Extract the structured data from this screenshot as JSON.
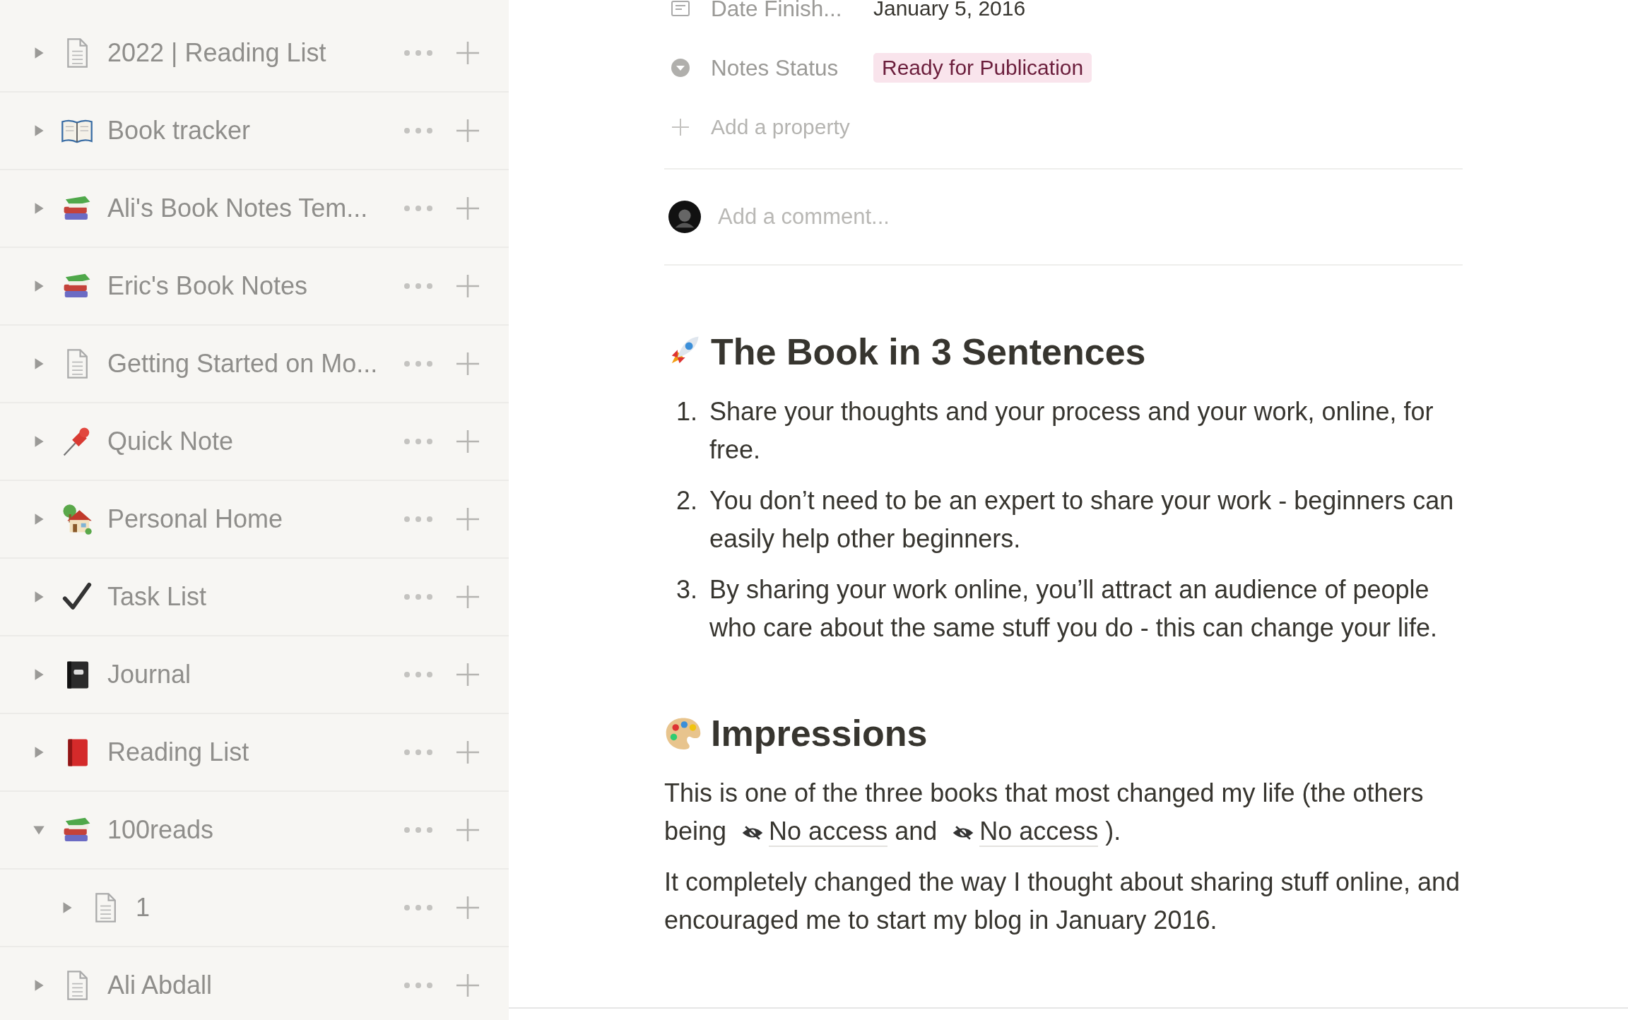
{
  "sidebar": {
    "items": [
      {
        "label": "2022 | Reading List",
        "kind": "page",
        "expanded": false
      },
      {
        "label": "Book tracker",
        "kind": "open-book",
        "expanded": false
      },
      {
        "label": "Ali's Book Notes Tem...",
        "kind": "books",
        "expanded": false
      },
      {
        "label": "Eric's Book Notes",
        "kind": "books",
        "expanded": false
      },
      {
        "label": "Getting Started on Mo...",
        "kind": "page",
        "expanded": false
      },
      {
        "label": "Quick Note",
        "kind": "pushpin",
        "expanded": false
      },
      {
        "label": "Personal Home",
        "kind": "house",
        "expanded": false
      },
      {
        "label": "Task List",
        "kind": "check",
        "expanded": false
      },
      {
        "label": "Journal",
        "kind": "notebook",
        "expanded": false
      },
      {
        "label": "Reading List",
        "kind": "red-book",
        "expanded": false
      },
      {
        "label": "100reads",
        "kind": "books",
        "expanded": true,
        "children": [
          {
            "label": "1",
            "kind": "page",
            "expanded": false
          }
        ]
      },
      {
        "label": "Ali Abdall",
        "kind": "page",
        "expanded": false
      }
    ]
  },
  "properties": [
    {
      "kind": "text",
      "name": "Date Finish...",
      "value": "January 5, 2016"
    },
    {
      "kind": "select",
      "name": "Notes Status",
      "value": "Ready for Publication",
      "color": "#f9e4ec"
    }
  ],
  "add_property": "Add a property",
  "comment": {
    "placeholder": "Add a comment..."
  },
  "sections": [
    {
      "kind": "rocket",
      "heading": "The Book in 3 Sentences",
      "list": [
        {
          "number": "1.",
          "text": "Share your thoughts and your process and your work, online, for free."
        },
        {
          "number": "2.",
          "text": "You don’t need to be an expert to share your work - beginners can easily help other beginners."
        },
        {
          "number": "3.",
          "text": "By sharing your work online, you’ll attract an audience of people who care about the same stuff you do - this can change your life."
        }
      ]
    },
    {
      "kind": "palette",
      "heading": "Impressions",
      "paragraphs": [
        [
          {
            "kind": "text",
            "text": "This is one of the three books that most changed my life (the others being "
          },
          {
            "kind": "mention",
            "text": "No access"
          },
          {
            "kind": "text",
            "text": " and "
          },
          {
            "kind": "mention",
            "text": "No access"
          },
          {
            "kind": "text",
            "text": " )."
          }
        ],
        [
          {
            "kind": "text",
            "text": "It completely changed the way I thought about sharing stuff online, and encouraged me to start my blog in January 2016."
          }
        ]
      ]
    }
  ]
}
